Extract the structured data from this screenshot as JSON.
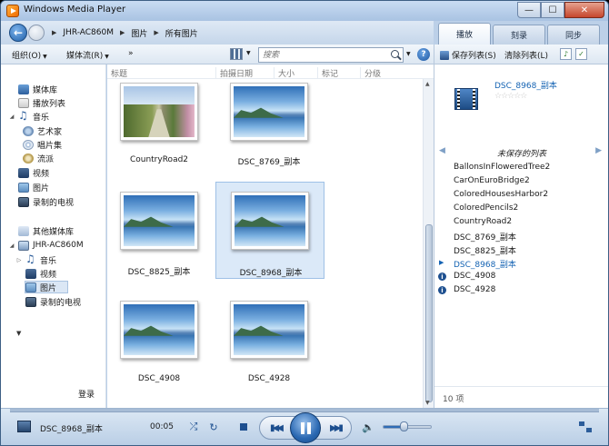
{
  "window": {
    "title": "Windows Media Player"
  },
  "breadcrumb": [
    "JHR-AC860M",
    "图片",
    "所有图片"
  ],
  "tabs": [
    {
      "label": "播放",
      "active": true
    },
    {
      "label": "刻录",
      "active": false
    },
    {
      "label": "同步",
      "active": false
    }
  ],
  "toolbar": {
    "organize": "组织(O)",
    "stream": "媒体流(R)",
    "more": "»"
  },
  "search": {
    "placeholder": "搜索"
  },
  "columns": [
    "标题",
    "拍摄日期",
    "大小",
    "标记",
    "分级"
  ],
  "sidebar": {
    "library": "媒体库",
    "playlists": "播放列表",
    "music": "音乐",
    "artist": "艺术家",
    "album": "唱片集",
    "genre": "流派",
    "video": "视频",
    "pictures": "图片",
    "recorded_tv": "录制的电视",
    "other_libraries": "其他媒体库",
    "remote": "JHR-AC860M",
    "remote_music": "音乐",
    "remote_video": "视频",
    "remote_pictures": "图片",
    "remote_tv": "录制的电视",
    "login": "登录"
  },
  "thumbnails": [
    {
      "name": "CountryRoad2",
      "kind": "road",
      "selected": false
    },
    {
      "name": "DSC_8769_副本",
      "kind": "lake",
      "selected": false
    },
    {
      "name": "DSC_8825_副本",
      "kind": "lake",
      "selected": false
    },
    {
      "name": "DSC_8968_副本",
      "kind": "lake",
      "selected": true
    },
    {
      "name": "DSC_4908",
      "kind": "lake",
      "selected": false
    },
    {
      "name": "DSC_4928",
      "kind": "lake",
      "selected": false
    }
  ],
  "right_panel": {
    "save_list": "保存列表(S)",
    "clear_list": "清除列表(L)",
    "now_playing": "DSC_8968_副本",
    "stars": "☆☆☆☆☆",
    "playlist_title": "未保存的列表",
    "items": [
      "BallonsInFloweredTree2",
      "CarOnEuroBridge2",
      "ColoredHousesHarbor2",
      "ColoredPencils2",
      "CountryRoad2",
      "DSC_8769_副本",
      "DSC_8825_副本",
      "DSC_8968_副本",
      "DSC_4908",
      "DSC_4928"
    ],
    "count": "10 项"
  },
  "player": {
    "title": "DSC_8968_副本",
    "time": "00:05",
    "volume_percent": 44
  },
  "colors": {
    "accent": "#1463b3",
    "selection": "#dbe9f8"
  }
}
